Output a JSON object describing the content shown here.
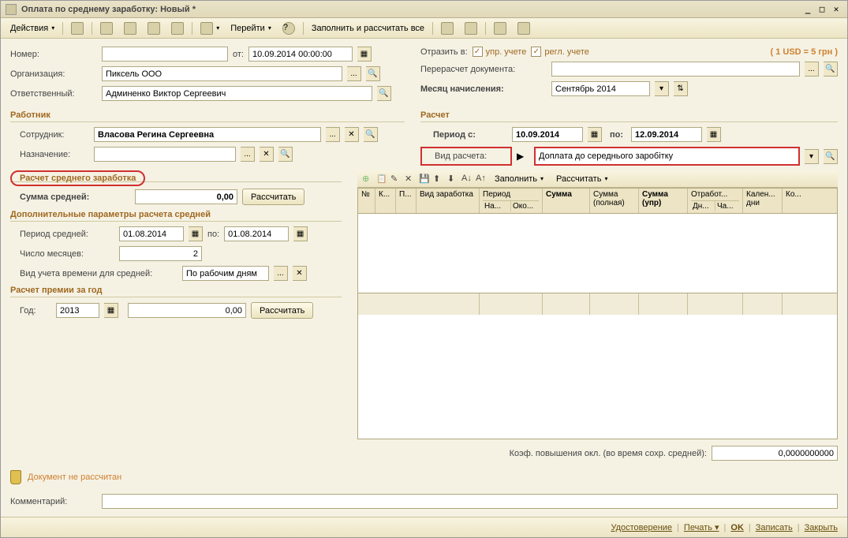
{
  "title": "Оплата по среднему заработку: Новый *",
  "toolbar": {
    "actions": "Действия",
    "goto": "Перейти",
    "fill_calc_all": "Заполнить и рассчитать все"
  },
  "header": {
    "number_lbl": "Номер:",
    "number": "",
    "from_lbl": "от:",
    "from_date": "10.09.2014 00:00:00",
    "org_lbl": "Организация:",
    "org": "Пиксель ООО",
    "resp_lbl": "Ответственный:",
    "resp": "Админенко Виктор Сергеевич",
    "reflect_lbl": "Отразить в:",
    "upr_chk": "упр. учете",
    "regl_chk": "регл. учете",
    "currency_note": "( 1 USD = 5 грн )",
    "recalc_lbl": "Перерасчет документа:",
    "recalc": "",
    "month_lbl": "Месяц начисления:",
    "month": "Сентябрь 2014"
  },
  "worker": {
    "title": "Работник",
    "emp_lbl": "Сотрудник:",
    "emp": "Власова Регина Сергеевна",
    "assign_lbl": "Назначение:",
    "assign": ""
  },
  "calc": {
    "title": "Расчет",
    "period_from_lbl": "Период с:",
    "period_from": "10.09.2014",
    "period_to_lbl": "по:",
    "period_to": "12.09.2014",
    "type_lbl": "Вид расчета:",
    "type": "Доплата до середнього заробітку"
  },
  "avg": {
    "title": "Расчет среднего заработка",
    "sum_lbl": "Сумма средней:",
    "sum": "0,00",
    "calc_btn": "Рассчитать",
    "extra_title": "Дополнительные параметры расчета средней",
    "period_lbl": "Период средней:",
    "period_from": "01.08.2014",
    "period_to_lbl": "по:",
    "period_to": "01.08.2014",
    "months_lbl": "Число месяцев:",
    "months": "2",
    "time_type_lbl": "Вид учета времени для средней:",
    "time_type": "По рабочим дням",
    "bonus_title": "Расчет премии за год",
    "year_lbl": "Год:",
    "year": "2013",
    "bonus_sum": "0,00",
    "bonus_calc_btn": "Рассчитать"
  },
  "grid": {
    "fill": "Заполнить",
    "calc": "Рассчитать",
    "cols": {
      "n": "№",
      "k": "К...",
      "p": "П...",
      "vid": "Вид заработка",
      "period": "Период",
      "period_from": "На...",
      "period_to": "Око...",
      "sum": "Сумма",
      "sum_full": "Сумма (полная)",
      "sum_upr": "Сумма (упр)",
      "worked": "Отработ...",
      "worked_d": "Дн...",
      "worked_h": "Ча...",
      "cal": "Кален... дни",
      "ko": "Ко..."
    },
    "coef_lbl": "Коэф. повышения окл. (во время сохр. средней):",
    "coef": "0,0000000000"
  },
  "warn": "Документ не рассчитан",
  "comment_lbl": "Комментарий:",
  "comment": "",
  "bottom": {
    "cert": "Удостоверение",
    "print": "Печать",
    "ok": "OK",
    "save": "Записать",
    "close": "Закрыть"
  }
}
